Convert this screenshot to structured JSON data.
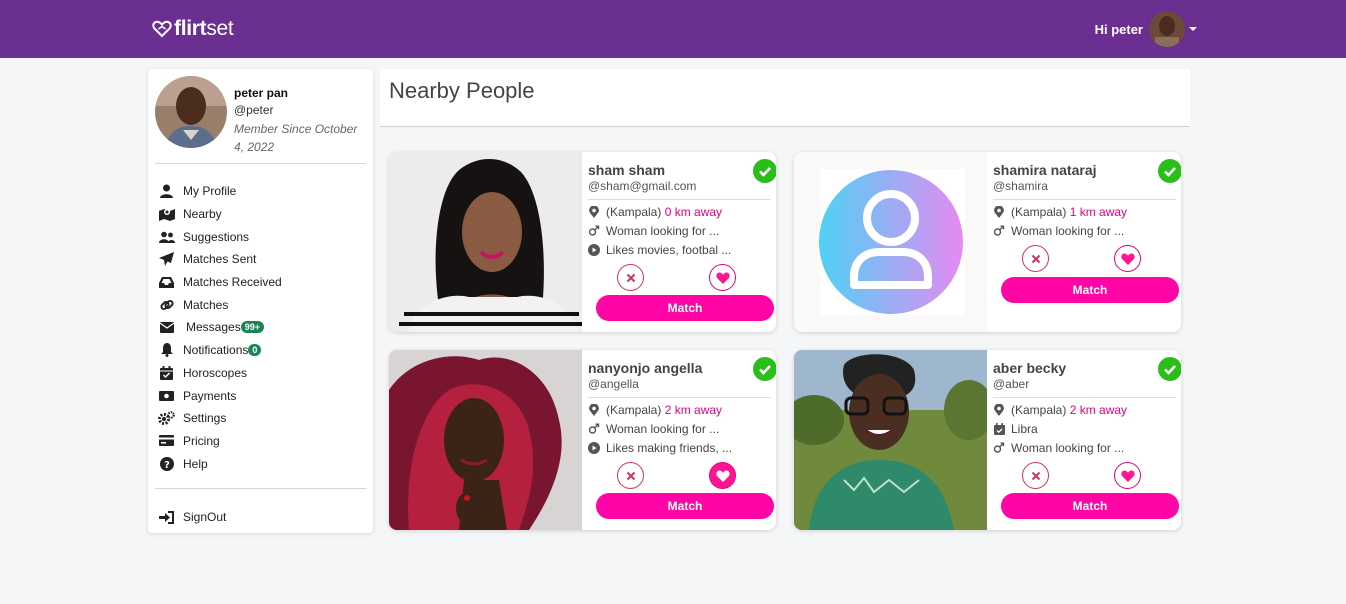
{
  "header": {
    "brand_bold": "flirt",
    "brand_light": "set",
    "greeting": "Hi peter"
  },
  "profile": {
    "name": "peter pan",
    "handle": "@peter",
    "member_since": "Member Since October 4, 2022"
  },
  "sidebar": {
    "items": [
      {
        "label": "My Profile",
        "icon": "user-icon"
      },
      {
        "label": "Nearby",
        "icon": "map-pin-icon"
      },
      {
        "label": "Suggestions",
        "icon": "users-icon"
      },
      {
        "label": "Matches Sent",
        "icon": "paper-plane-icon"
      },
      {
        "label": "Matches Received",
        "icon": "inbox-icon"
      },
      {
        "label": "Matches",
        "icon": "link-icon"
      },
      {
        "label": "Messages",
        "icon": "envelope-icon",
        "badge": "99+"
      },
      {
        "label": "Notifications",
        "icon": "bell-icon",
        "badge": "0"
      },
      {
        "label": "Horoscopes",
        "icon": "calendar-check-icon"
      },
      {
        "label": "Payments",
        "icon": "money-bill-icon"
      },
      {
        "label": "Settings",
        "icon": "gears-icon"
      },
      {
        "label": "Pricing",
        "icon": "credit-card-icon"
      },
      {
        "label": "Help",
        "icon": "question-circle-icon"
      }
    ],
    "signout": "SignOut"
  },
  "main": {
    "title": "Nearby People",
    "match_label": "Match",
    "people": [
      {
        "name": "sham sham",
        "handle": "@sham@gmail.com",
        "location": "(Kampala)",
        "distance": "0 km away",
        "looking": "Woman looking for ...",
        "likes": "Likes movies, footbal ...",
        "verified": true
      },
      {
        "name": "shamira nataraj",
        "handle": "@shamira",
        "location": "(Kampala)",
        "distance": "1 km away",
        "looking": "Woman looking for ...",
        "verified": true
      },
      {
        "name": "nanyonjo angella",
        "handle": "@angella",
        "location": "(Kampala)",
        "distance": "2 km away",
        "looking": "Woman looking for ...",
        "likes": "Likes making friends, ...",
        "verified": true
      },
      {
        "name": "aber becky",
        "handle": "@aber",
        "location": "(Kampala)",
        "distance": "2 km away",
        "zodiac": "Libra",
        "looking": "Woman looking for ...",
        "verified": true
      }
    ]
  },
  "colors": {
    "topbar": "#6b2e91",
    "accent": "#ff05a5",
    "distance": "#e6007e",
    "verified": "#2bbd1a",
    "badge": "#198754"
  }
}
